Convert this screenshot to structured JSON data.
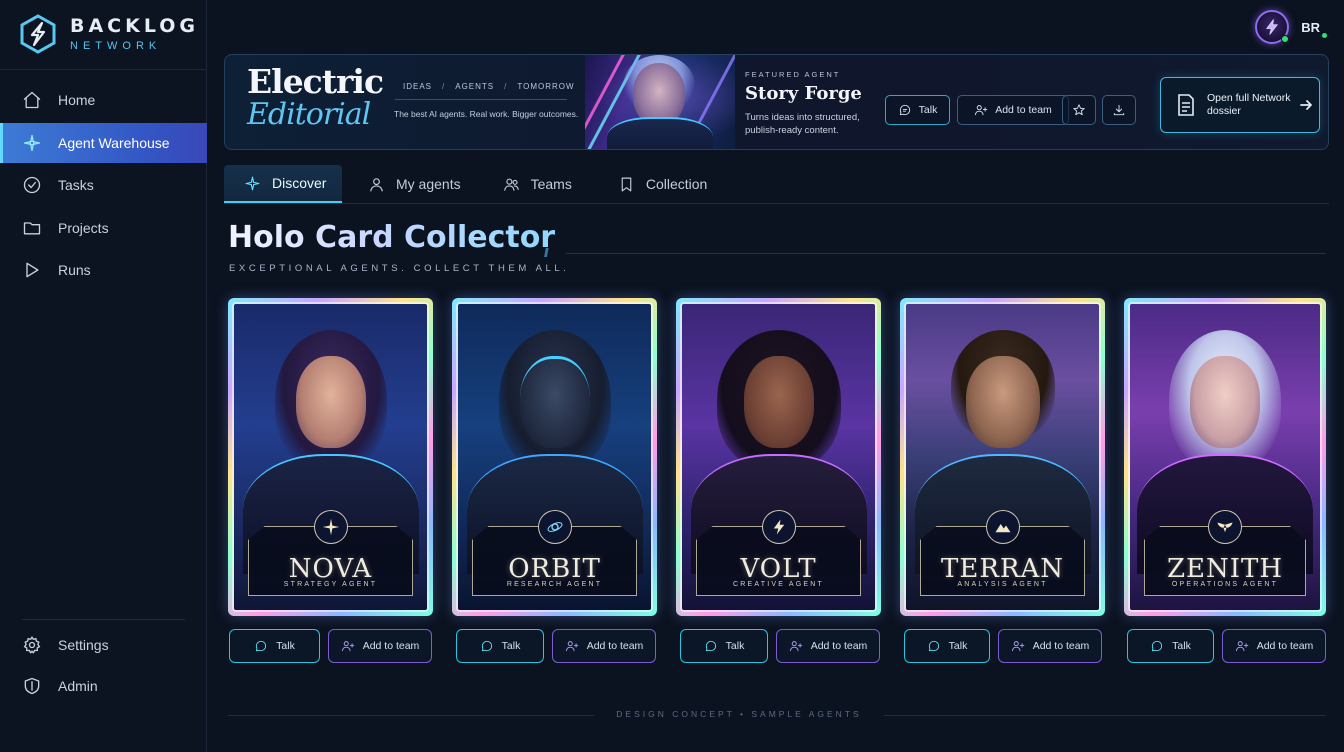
{
  "app": {
    "logo_title": "BACKLOG",
    "logo_subtitle": "NETWORK",
    "accent": "#3fd1f5",
    "brand_purple": "#7c5cd6"
  },
  "sidebar": {
    "items": [
      {
        "label": "Home",
        "icon": "home-icon"
      },
      {
        "label": "Agent Warehouse",
        "icon": "sparkle-icon",
        "active": true
      },
      {
        "label": "Tasks",
        "icon": "check-circle-icon"
      },
      {
        "label": "Projects",
        "icon": "folder-icon"
      },
      {
        "label": "Runs",
        "icon": "play-icon"
      }
    ],
    "bottom_items": [
      {
        "label": "Settings",
        "icon": "gear-icon"
      },
      {
        "label": "Admin",
        "icon": "shield-icon"
      }
    ]
  },
  "user": {
    "initials": "BR",
    "avatar_icon": "lightning-icon",
    "status": "online"
  },
  "hero": {
    "brand_line1": "Electric",
    "brand_line2": "Editorial",
    "crumbs": [
      "IDEAS",
      "AGENTS",
      "TOMORROW"
    ],
    "crumb_sep": "/",
    "tagline": "The best AI agents. Real work. Bigger outcomes.",
    "featured_label": "FEATURED AGENT",
    "featured_title": "Story Forge",
    "featured_desc": "Turns ideas into structured, publish-ready content.",
    "talk_label": "Talk",
    "add_label": "Add to team",
    "dossier_label": "Open full Network dossier"
  },
  "tabs": [
    {
      "label": "Discover",
      "icon": "sparkle-icon",
      "active": true
    },
    {
      "label": "My agents",
      "icon": "user-icon"
    },
    {
      "label": "Teams",
      "icon": "users-icon"
    },
    {
      "label": "Collection",
      "icon": "bookmark-icon"
    }
  ],
  "section": {
    "title": "Holo Card Collector",
    "subtitle": "EXCEPTIONAL AGENTS. COLLECT THEM ALL."
  },
  "cards": [
    {
      "name": "NOVA",
      "role": "STRATEGY AGENT",
      "emblem": "compass-star-icon",
      "talk": "Talk",
      "add": "Add to team"
    },
    {
      "name": "ORBIT",
      "role": "RESEARCH AGENT",
      "emblem": "orbit-icon",
      "talk": "Talk",
      "add": "Add to team"
    },
    {
      "name": "VOLT",
      "role": "CREATIVE AGENT",
      "emblem": "lightning-icon",
      "talk": "Talk",
      "add": "Add to team"
    },
    {
      "name": "TERRAN",
      "role": "ANALYSIS AGENT",
      "emblem": "mountain-icon",
      "talk": "Talk",
      "add": "Add to team"
    },
    {
      "name": "ZENITH",
      "role": "OPERATIONS AGENT",
      "emblem": "wings-icon",
      "talk": "Talk",
      "add": "Add to team"
    }
  ],
  "footer": {
    "text": "DESIGN CONCEPT  •  SAMPLE AGENTS"
  }
}
